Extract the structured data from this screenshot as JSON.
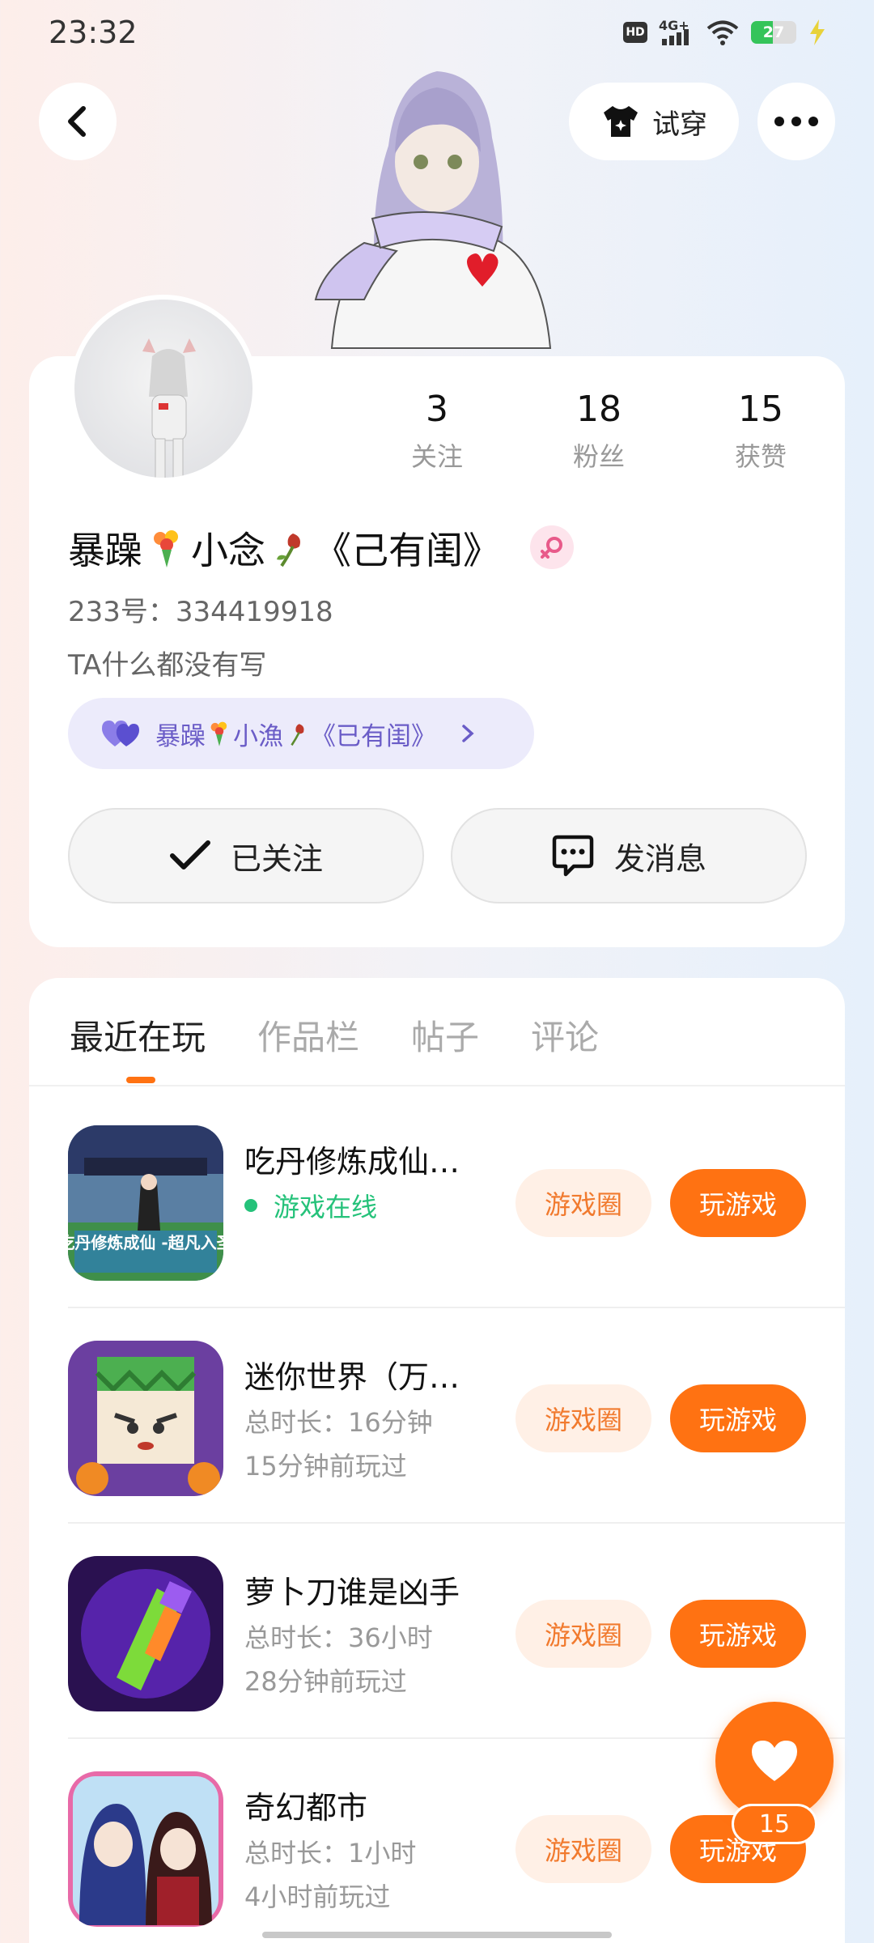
{
  "status_bar": {
    "time": "23:32",
    "hd": "HD",
    "network": "4G+",
    "battery": "27",
    "battery_level": 0.27
  },
  "header": {
    "tryon_label": "试穿",
    "back_icon": "chevron-left-icon",
    "more_icon": "more-dots-icon",
    "tryon_icon": "tshirt-sparkle-icon"
  },
  "profile": {
    "stats": [
      {
        "value": "3",
        "label": "关注"
      },
      {
        "value": "18",
        "label": "粉丝"
      },
      {
        "value": "15",
        "label": "获赞"
      }
    ],
    "nickname_parts": [
      "暴躁",
      "小念",
      "《己有闺》"
    ],
    "gender": "female",
    "uid": "233号：334419918",
    "bio": "TA什么都没有写",
    "cp_parts": [
      "暴躁",
      "小漁",
      "《已有闺》"
    ],
    "follow_label": "已关注",
    "message_label": "发消息"
  },
  "tabs": [
    "最近在玩",
    "作品栏",
    "帖子",
    "评论"
  ],
  "active_tab": 0,
  "games": [
    {
      "title": "吃丹修炼成仙…",
      "sub1": "游戏在线",
      "sub2": "",
      "online": true,
      "circle_label": "游戏圈",
      "play_label": "玩游戏",
      "icon_text": "吃丹修炼成仙 -超凡入圣"
    },
    {
      "title": "迷你世界（万…",
      "sub1": "总时长：16分钟",
      "sub2": "15分钟前玩过",
      "online": false,
      "circle_label": "游戏圈",
      "play_label": "玩游戏"
    },
    {
      "title": "萝卜刀谁是凶手",
      "sub1": "总时长：36小时",
      "sub2": "28分钟前玩过",
      "online": false,
      "circle_label": "游戏圈",
      "play_label": "玩游戏"
    },
    {
      "title": "奇幻都市",
      "sub1": "总时长：1小时",
      "sub2": "4小时前玩过",
      "online": false,
      "circle_label": "游戏圈",
      "play_label": "玩游戏"
    }
  ],
  "like": {
    "count": "15",
    "icon": "heart-icon"
  },
  "colors": {
    "accent": "#ff7212",
    "online": "#25c27a",
    "cp_text": "#6a5cc7"
  }
}
